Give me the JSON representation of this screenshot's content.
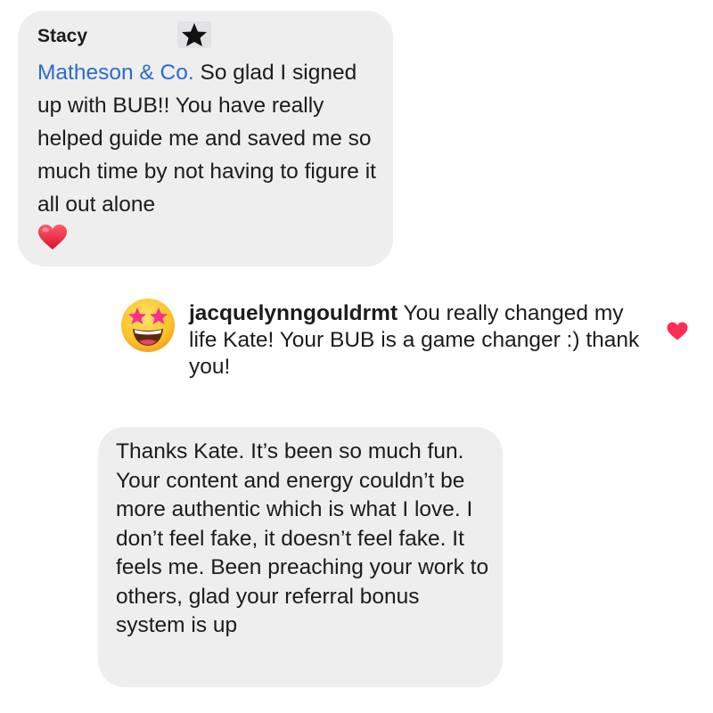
{
  "comments": [
    {
      "author": "Stacy",
      "mention": "Matheson & Co.",
      "text": "So glad I signed up with BUB!! You have really helped  guide me and saved me so much time by not having to figure it all out alone",
      "reaction_icon": "heart-emoji",
      "badge_icon": "star-icon"
    },
    {
      "username": "jacquelynngouldrmt",
      "text": "You really changed my life Kate! Your BUB is a game changer :) thank you!",
      "avatar_icon": "star-struck-emoji",
      "like_icon": "heart-icon",
      "like_color": "#ff2d55"
    },
    {
      "text": "Thanks Kate. It’s been so much fun. Your content and energy couldn’t be more authentic which is what I love. I don’t feel fake, it doesn’t feel fake. It feels me. Been preaching your work to others, glad your referral bonus system is up"
    }
  ],
  "colors": {
    "bubble_background": "#eeeeef",
    "mention": "#2a6bd1",
    "text": "#1c1c1e"
  }
}
